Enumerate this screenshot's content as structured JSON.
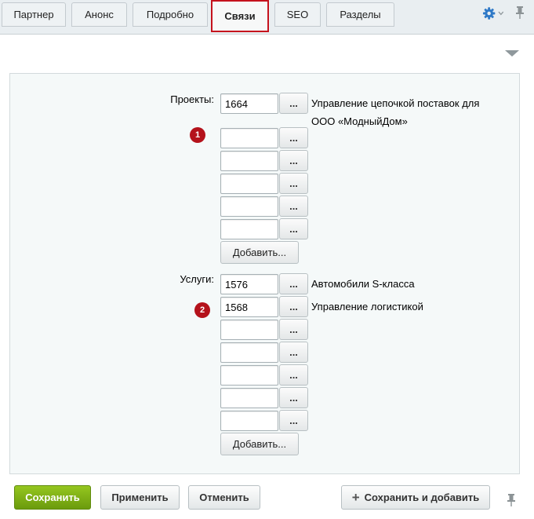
{
  "tabs": [
    {
      "label": "Партнер"
    },
    {
      "label": "Анонс"
    },
    {
      "label": "Подробно"
    },
    {
      "label": "Связи",
      "active": true
    },
    {
      "label": "SEO"
    },
    {
      "label": "Разделы"
    }
  ],
  "icons": {
    "settings": "gear-icon",
    "dropdown": "chevron-down-icon",
    "pin": "pin-icon",
    "collapse": "triangle-down-icon",
    "add": "plus-icon"
  },
  "colors": {
    "accent_blue": "#2f79c7",
    "active_tab_border": "#c5121d",
    "marker": "#b4121b",
    "primary_button": "#7eb116"
  },
  "projects": {
    "label": "Проекты:",
    "rows": [
      {
        "value": "1664",
        "description": "Управление цепочкой поставок для ООО «МодныйДом»"
      },
      {
        "value": "",
        "description": ""
      },
      {
        "value": "",
        "description": ""
      },
      {
        "value": "",
        "description": ""
      },
      {
        "value": "",
        "description": ""
      },
      {
        "value": "",
        "description": ""
      }
    ],
    "browse_label": "...",
    "add_label": "Добавить...",
    "marker": "1"
  },
  "services": {
    "label": "Услуги:",
    "rows": [
      {
        "value": "1576",
        "description": "Автомобили S-класса"
      },
      {
        "value": "1568",
        "description": "Управление логистикой"
      },
      {
        "value": "",
        "description": ""
      },
      {
        "value": "",
        "description": ""
      },
      {
        "value": "",
        "description": ""
      },
      {
        "value": "",
        "description": ""
      },
      {
        "value": "",
        "description": ""
      }
    ],
    "browse_label": "...",
    "add_label": "Добавить...",
    "marker": "2"
  },
  "footer": {
    "save_label": "Сохранить",
    "apply_label": "Применить",
    "cancel_label": "Отменить",
    "save_and_add_label": "Сохранить и добавить"
  }
}
